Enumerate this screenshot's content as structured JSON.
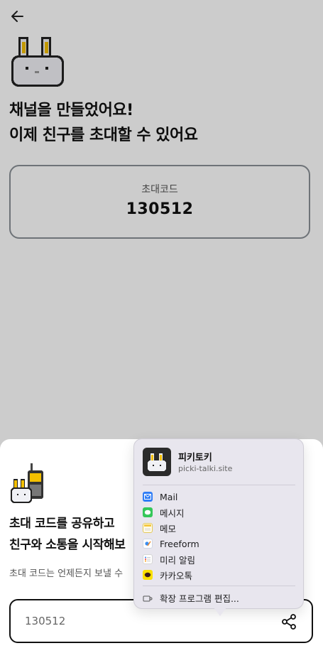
{
  "header": {
    "back_icon": "arrow-left-icon"
  },
  "hero": {
    "title_line1": "채널을 만들었어요!",
    "title_line2": "이제 친구를 초대할 수 있어요"
  },
  "code_card": {
    "label": "초대코드",
    "value": "130512"
  },
  "sheet": {
    "title_line1": "초대 코드를 공유하고",
    "title_line2": "친구와 소통을 시작해보",
    "description": "초대 코드는 언제든지 보낼 수",
    "input_value": "130512",
    "share_icon": "share-icon"
  },
  "share_menu": {
    "app_name": "피키토키",
    "app_url": "picki-talki.site",
    "items": [
      {
        "label": "Mail",
        "icon": "mail-icon",
        "color": "#2f7df6"
      },
      {
        "label": "메시지",
        "icon": "messages-icon",
        "color": "#34c759"
      },
      {
        "label": "메모",
        "icon": "notes-icon",
        "color": "#f5c842"
      },
      {
        "label": "Freeform",
        "icon": "freeform-icon",
        "color": "#3a8ef0"
      },
      {
        "label": "미리 알림",
        "icon": "reminders-icon",
        "color": "#ff9500"
      },
      {
        "label": "카카오톡",
        "icon": "kakaotalk-icon",
        "color": "#fae100"
      }
    ],
    "edit_label": "확장 프로그램 편집..."
  },
  "colors": {
    "overlay": "rgba(0,0,0,0.2)",
    "card_border": "#8a9096",
    "popover_bg": "#e8e6ee"
  }
}
